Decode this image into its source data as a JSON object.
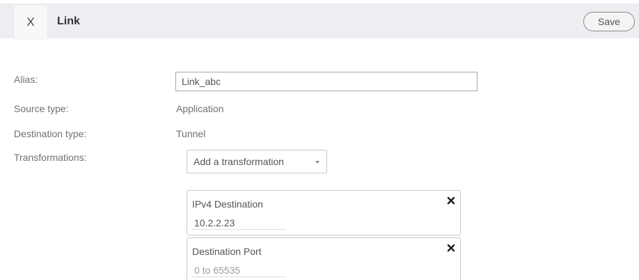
{
  "header": {
    "close_label": "X",
    "title": "Link",
    "save_label": "Save"
  },
  "form": {
    "alias": {
      "label": "Alias:",
      "value": "Link_abc"
    },
    "source_type": {
      "label": "Source type:",
      "value": "Application"
    },
    "destination_type": {
      "label": "Destination type:",
      "value": "Tunnel"
    },
    "transformations": {
      "label": "Transformations:",
      "select_label": "Add a transformation",
      "items": [
        {
          "title": "IPv4 Destination",
          "value": "10.2.2.23",
          "placeholder": ""
        },
        {
          "title": "Destination Port",
          "value": "",
          "placeholder": "0 to 65535"
        }
      ]
    }
  },
  "colors": {
    "header_bg": "#eceef2",
    "label_text": "#707070",
    "border": "#c8c8c8"
  }
}
